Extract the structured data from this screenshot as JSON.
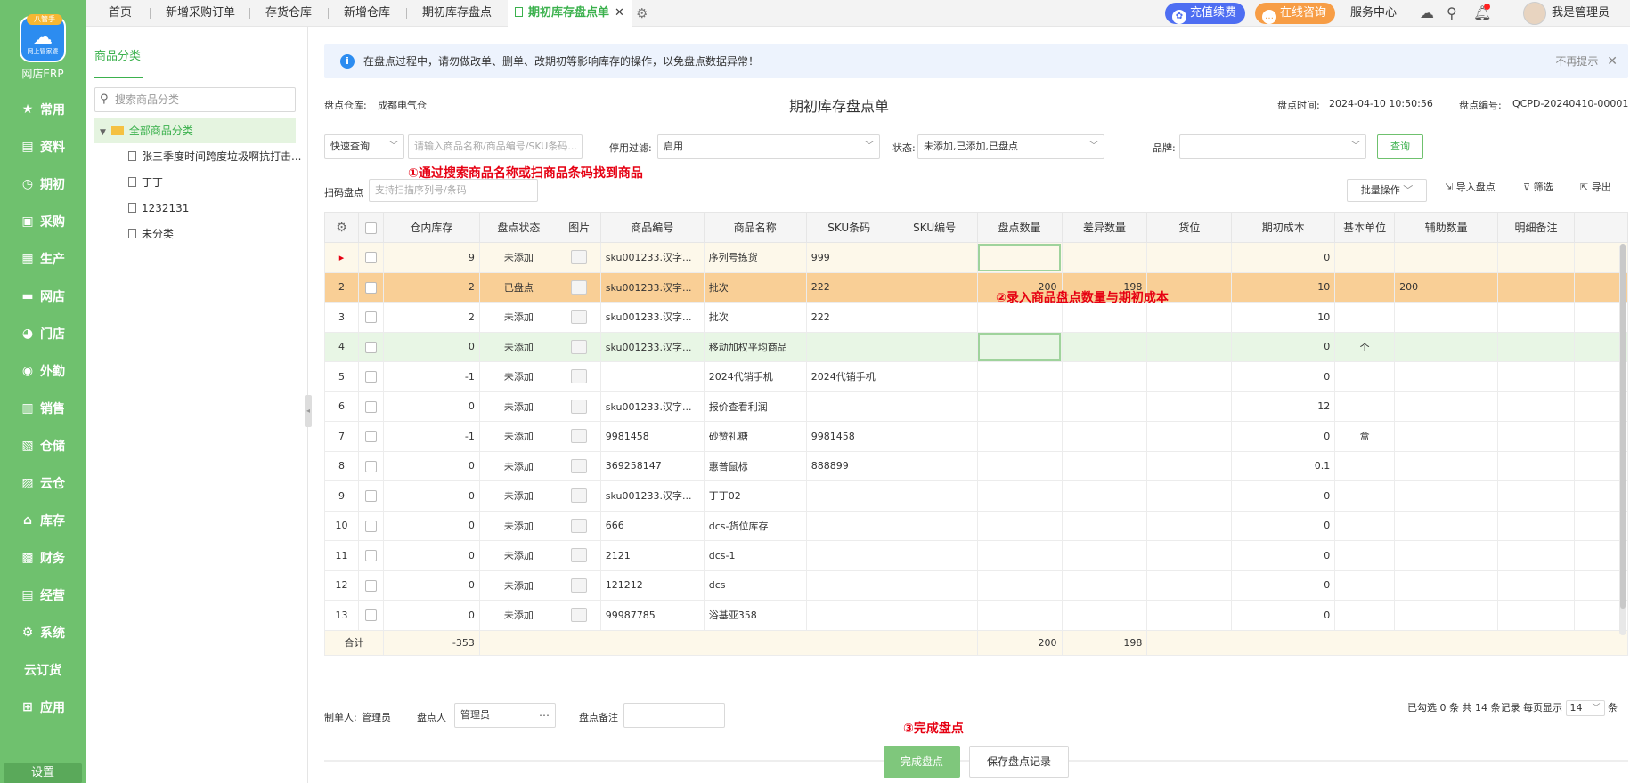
{
  "nav": {
    "brand": "网店ERP",
    "logo_badge": "八管手",
    "logo_text": "网上管家婆",
    "items": [
      {
        "label": "常用",
        "icon": "star-icon"
      },
      {
        "label": "资料",
        "icon": "file-icon"
      },
      {
        "label": "期初",
        "icon": "clock-icon"
      },
      {
        "label": "采购",
        "icon": "cart-icon"
      },
      {
        "label": "生产",
        "icon": "factory-icon"
      },
      {
        "label": "网店",
        "icon": "store-icon"
      },
      {
        "label": "门店",
        "icon": "shop-icon"
      },
      {
        "label": "外勤",
        "icon": "location-icon"
      },
      {
        "label": "销售",
        "icon": "chart-icon"
      },
      {
        "label": "仓储",
        "icon": "warehouse-icon"
      },
      {
        "label": "云仓",
        "icon": "cloud-warehouse-icon"
      },
      {
        "label": "库存",
        "icon": "home-icon"
      },
      {
        "label": "财务",
        "icon": "money-icon"
      },
      {
        "label": "经营",
        "icon": "business-icon"
      },
      {
        "label": "系统",
        "icon": "gear-icon"
      },
      {
        "label": "云订货",
        "icon": ""
      },
      {
        "label": "应用",
        "icon": "plus-icon"
      }
    ],
    "settings": "设置"
  },
  "tabs": [
    "首页",
    "新增采购订单",
    "存货仓库",
    "新增仓库",
    "期初库存盘点",
    "期初库存盘点单"
  ],
  "header": {
    "recharge": "充值续费",
    "consult": "在线咨询",
    "service": "服务中心",
    "user": "我是管理员"
  },
  "category": {
    "title": "商品分类",
    "search_placeholder": "搜索商品分类",
    "root": "全部商品分类",
    "children": [
      "张三季度时间跨度垃圾啊抗打击...",
      "丁丁",
      "1232131",
      "未分类"
    ]
  },
  "notice": {
    "text": "在盘点过程中，请勿做改单、删单、改期初等影响库存的操作，以免盘点数据异常！",
    "dismiss": "不再提示"
  },
  "doc": {
    "warehouse_label": "盘点仓库:",
    "warehouse": "成都电气仓",
    "title": "期初库存盘点单",
    "time_label": "盘点时间:",
    "time": "2024-04-10 10:50:56",
    "no_label": "盘点编号:",
    "no": "QCPD-20240410-00001"
  },
  "filters": {
    "quick": "快速查询",
    "keyword_placeholder": "请输入商品名称/商品编号/SKU条码...",
    "disabled_label": "停用过滤:",
    "disabled_value": "启用",
    "status_label": "状态:",
    "status_value": "未添加,已添加,已盘点",
    "brand_label": "品牌:",
    "brand_value": "",
    "query": "查询",
    "scan_label": "扫码盘点",
    "scan_placeholder": "支持扫描序列号/条码"
  },
  "toolbar": {
    "batch": "批量操作",
    "import": "导入盘点",
    "filter": "筛选",
    "export": "导出"
  },
  "annotations": {
    "a1": "①通过搜索商品名称或扫商品条码找到商品",
    "a2": "②录入商品盘点数量与期初成本",
    "a3": "③完成盘点"
  },
  "table": {
    "columns": [
      "仓内库存",
      "盘点状态",
      "图片",
      "商品编号",
      "商品名称",
      "SKU条码",
      "SKU编号",
      "盘点数量",
      "差异数量",
      "货位",
      "期初成本",
      "基本单位",
      "辅助数量",
      "明细备注"
    ],
    "rows": [
      {
        "idx": "▸",
        "stock": "9",
        "status": "未添加",
        "code": "sku001233.汉字...",
        "name": "序列号拣货",
        "sku": "999",
        "skuno": "",
        "count": "",
        "diff": "",
        "loc": "",
        "cost": "0",
        "unit": "",
        "aux": "",
        "note": ""
      },
      {
        "idx": "2",
        "stock": "2",
        "status": "已盘点",
        "code": "sku001233.汉字...",
        "name": "批次",
        "sku": "222",
        "skuno": "",
        "count": "200",
        "diff": "198",
        "loc": "",
        "cost": "10",
        "unit": "",
        "aux": "200",
        "note": ""
      },
      {
        "idx": "3",
        "stock": "2",
        "status": "未添加",
        "code": "sku001233.汉字...",
        "name": "批次",
        "sku": "222",
        "skuno": "",
        "count": "",
        "diff": "",
        "loc": "",
        "cost": "10",
        "unit": "",
        "aux": "",
        "note": ""
      },
      {
        "idx": "4",
        "stock": "0",
        "status": "未添加",
        "code": "sku001233.汉字...",
        "name": "移动加权平均商品",
        "sku": "",
        "skuno": "",
        "count": "",
        "diff": "",
        "loc": "",
        "cost": "0",
        "unit": "个",
        "aux": "",
        "note": ""
      },
      {
        "idx": "5",
        "stock": "-1",
        "status": "未添加",
        "code": "",
        "name": "2024代销手机",
        "sku": "2024代销手机",
        "skuno": "",
        "count": "",
        "diff": "",
        "loc": "",
        "cost": "0",
        "unit": "",
        "aux": "",
        "note": ""
      },
      {
        "idx": "6",
        "stock": "0",
        "status": "未添加",
        "code": "sku001233.汉字...",
        "name": "报价查看利润",
        "sku": "",
        "skuno": "",
        "count": "",
        "diff": "",
        "loc": "",
        "cost": "12",
        "unit": "",
        "aux": "",
        "note": ""
      },
      {
        "idx": "7",
        "stock": "-1",
        "status": "未添加",
        "code": "9981458",
        "name": "砂赞礼糖",
        "sku": "9981458",
        "skuno": "",
        "count": "",
        "diff": "",
        "loc": "",
        "cost": "0",
        "unit": "盒",
        "aux": "",
        "note": ""
      },
      {
        "idx": "8",
        "stock": "0",
        "status": "未添加",
        "code": "369258147",
        "name": "惠普鼠标",
        "sku": "888899",
        "skuno": "",
        "count": "",
        "diff": "",
        "loc": "",
        "cost": "0.1",
        "unit": "",
        "aux": "",
        "note": ""
      },
      {
        "idx": "9",
        "stock": "0",
        "status": "未添加",
        "code": "sku001233.汉字...",
        "name": "丁丁02",
        "sku": "",
        "skuno": "",
        "count": "",
        "diff": "",
        "loc": "",
        "cost": "0",
        "unit": "",
        "aux": "",
        "note": ""
      },
      {
        "idx": "10",
        "stock": "0",
        "status": "未添加",
        "code": "666",
        "name": "dcs-货位库存",
        "sku": "",
        "skuno": "",
        "count": "",
        "diff": "",
        "loc": "",
        "cost": "0",
        "unit": "",
        "aux": "",
        "note": ""
      },
      {
        "idx": "11",
        "stock": "0",
        "status": "未添加",
        "code": "2121",
        "name": "dcs-1",
        "sku": "",
        "skuno": "",
        "count": "",
        "diff": "",
        "loc": "",
        "cost": "0",
        "unit": "",
        "aux": "",
        "note": ""
      },
      {
        "idx": "12",
        "stock": "0",
        "status": "未添加",
        "code": "121212",
        "name": "dcs",
        "sku": "",
        "skuno": "",
        "count": "",
        "diff": "",
        "loc": "",
        "cost": "0",
        "unit": "",
        "aux": "",
        "note": ""
      },
      {
        "idx": "13",
        "stock": "0",
        "status": "未添加",
        "code": "99987785",
        "name": "浴基亚358",
        "sku": "",
        "skuno": "",
        "count": "",
        "diff": "",
        "loc": "",
        "cost": "0",
        "unit": "",
        "aux": "",
        "note": ""
      }
    ],
    "sum_label": "合计",
    "sum_stock": "-353",
    "sum_count": "200",
    "sum_diff": "198"
  },
  "pagination": {
    "info": "已勾选 0 条 共 14 条记录 每页显示",
    "page_size": "14",
    "unit": "条"
  },
  "form": {
    "maker_label": "制单人:",
    "maker": "管理员",
    "checker_label": "盘点人",
    "checker": "管理员",
    "remark_label": "盘点备注",
    "remark": ""
  },
  "actions": {
    "complete": "完成盘点",
    "save": "保存盘点记录"
  },
  "colors": {
    "nav_green": "#6fc16e",
    "accent_green": "#3bb14d",
    "row_selected": "#f9cf96",
    "annotation_red": "#e60012"
  }
}
